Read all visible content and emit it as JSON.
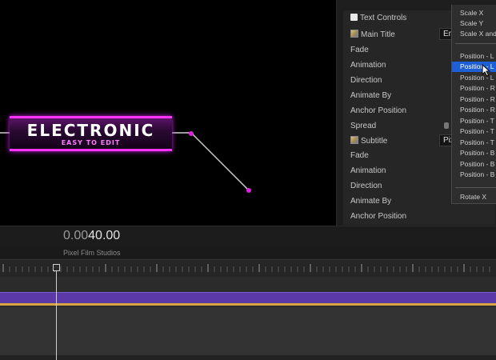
{
  "viewer": {
    "title_text": "ELECTRONIC",
    "subtitle_text": "EASY TO  EDIT",
    "colors": {
      "accent": "#ff35ff",
      "keyframe": "#e020e0"
    }
  },
  "inspector": {
    "params": [
      {
        "label": "Text Controls",
        "icon": "checkbox-icon"
      },
      {
        "label": "Main Title",
        "icon": "text-layer-icon"
      },
      {
        "label": "Fade"
      },
      {
        "label": "Animation"
      },
      {
        "label": "Direction"
      },
      {
        "label": "Animate By"
      },
      {
        "label": "Anchor Position"
      },
      {
        "label": "Spread"
      },
      {
        "label": "Subtitle",
        "icon": "text-layer-icon"
      },
      {
        "label": "Fade"
      },
      {
        "label": "Animation"
      },
      {
        "label": "Direction"
      },
      {
        "label": "Animate By"
      },
      {
        "label": "Anchor Position"
      }
    ],
    "main_title_value": "En",
    "subtitle_value": "Pix"
  },
  "menu": {
    "items_top": [
      "Scale X",
      "Scale Y",
      "Scale X and"
    ],
    "items": [
      "Position - L",
      "Position - L",
      "Position - L",
      "Position - R",
      "Position - R",
      "Position - R",
      "Position - T",
      "Position - T",
      "Position - T",
      "Position - B",
      "Position - B",
      "Position - B"
    ],
    "selected_index": 1,
    "items_bottom": [
      "Rotate X"
    ]
  },
  "timeline": {
    "timecode_dim": "0.00",
    "timecode_strong": "40.00",
    "project_name": "Pixel Film Studios",
    "colors": {
      "clip": "#5b3aa8",
      "clip_edge": "#d9a441"
    }
  }
}
